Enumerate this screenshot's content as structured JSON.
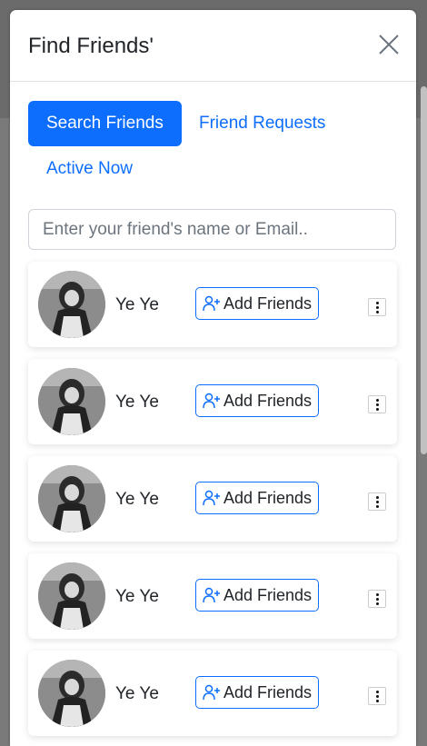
{
  "modal": {
    "title": "Find Friends'",
    "close_icon": "close-icon"
  },
  "tabs": [
    {
      "label": "Search Friends",
      "active": true
    },
    {
      "label": "Friend Requests",
      "active": false
    },
    {
      "label": "Active Now",
      "active": false
    }
  ],
  "search": {
    "placeholder": "Enter your friend's name or Email.."
  },
  "results": [
    {
      "name": "Ye Ye",
      "button_label": "Add Friends"
    },
    {
      "name": "Ye Ye",
      "button_label": "Add Friends"
    },
    {
      "name": "Ye Ye",
      "button_label": "Add Friends"
    },
    {
      "name": "Ye Ye",
      "button_label": "Add Friends"
    },
    {
      "name": "Ye Ye",
      "button_label": "Add Friends"
    }
  ],
  "colors": {
    "primary": "#0d6efd",
    "text": "#212529",
    "backdrop": "#7a7a7a"
  }
}
